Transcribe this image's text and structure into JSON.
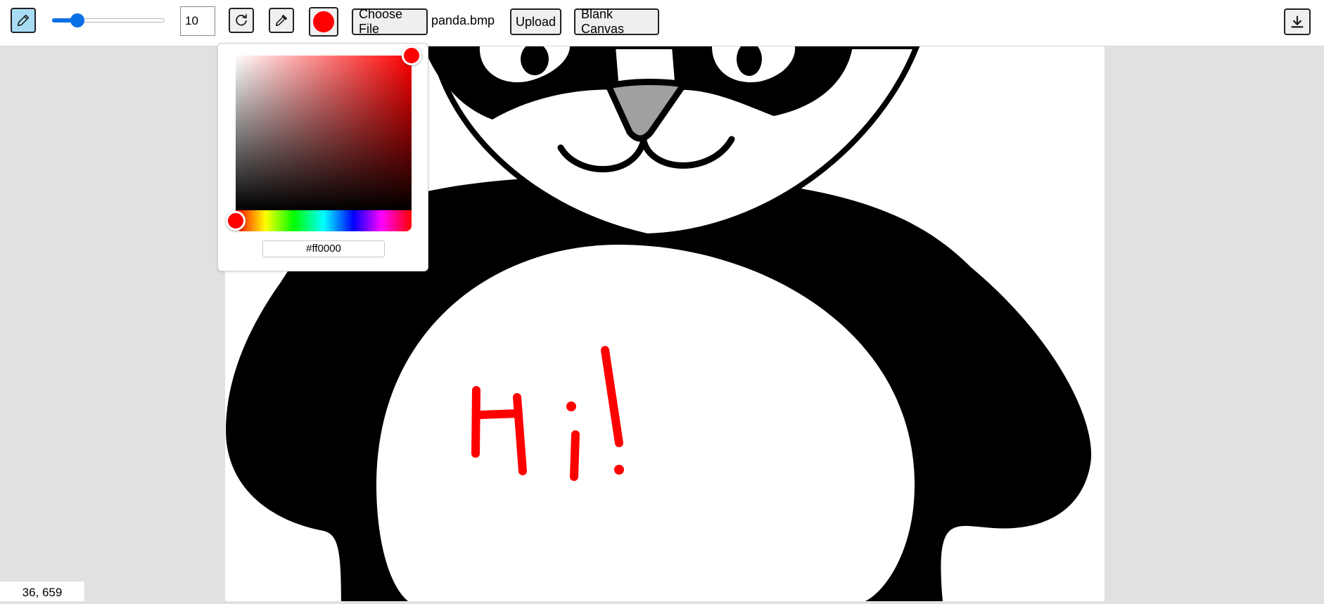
{
  "toolbar": {
    "brush_size": 10,
    "brush_size_min": 1,
    "brush_size_max": 50,
    "current_color": "#ff0000",
    "choose_file_label": "Choose File",
    "file_name": "panda.bmp",
    "upload_label": "Upload",
    "blank_canvas_label": "Blank Canvas"
  },
  "color_picker": {
    "hex_value": "#ff0000",
    "hue_degrees": 0,
    "saturation": 1,
    "value": 1
  },
  "canvas": {
    "drawn_text": "Hi!"
  },
  "status": {
    "cursor_coords": "36, 659"
  },
  "icons": {
    "pencil": "pencil-icon",
    "reset": "refresh-icon",
    "eyedropper": "eyedropper-icon",
    "download": "download-icon"
  }
}
